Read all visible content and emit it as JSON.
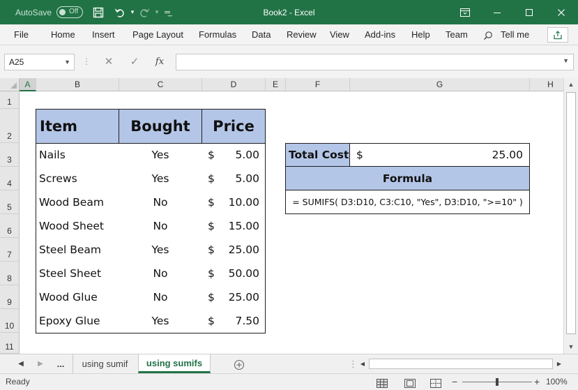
{
  "titlebar": {
    "autosave_label": "AutoSave",
    "autosave_state": "Off",
    "document_title": "Book2  -  Excel",
    "icons": [
      "save-icon",
      "undo-icon",
      "redo-icon",
      "customize-qat-icon",
      "ribbon-display-icon",
      "minimize-icon",
      "maximize-icon",
      "close-icon"
    ]
  },
  "ribbon": {
    "tabs": [
      "File",
      "Home",
      "Insert",
      "Page Layout",
      "Formulas",
      "Data",
      "Review",
      "View",
      "Add-ins",
      "Help",
      "Team"
    ],
    "tell_me": "Tell me"
  },
  "formula_bar": {
    "name_box": "A25",
    "fx_label": "fx",
    "formula": ""
  },
  "grid": {
    "columns": [
      "A",
      "B",
      "C",
      "D",
      "E",
      "F",
      "G",
      "H"
    ],
    "selected_column": "A",
    "rows": [
      "1",
      "2",
      "3",
      "4",
      "5",
      "6",
      "7",
      "8",
      "9",
      "10",
      "11"
    ]
  },
  "table": {
    "headers": [
      "Item",
      "Bought",
      "Price"
    ],
    "rows": [
      {
        "item": "Nails",
        "bought": "Yes",
        "currency": "$",
        "price": "5.00"
      },
      {
        "item": "Screws",
        "bought": "Yes",
        "currency": "$",
        "price": "5.00"
      },
      {
        "item": "Wood Beam",
        "bought": "No",
        "currency": "$",
        "price": "10.00"
      },
      {
        "item": "Wood Sheet",
        "bought": "No",
        "currency": "$",
        "price": "15.00"
      },
      {
        "item": "Steel Beam",
        "bought": "Yes",
        "currency": "$",
        "price": "25.00"
      },
      {
        "item": "Steel Sheet",
        "bought": "No",
        "currency": "$",
        "price": "50.00"
      },
      {
        "item": "Wood Glue",
        "bought": "No",
        "currency": "$",
        "price": "25.00"
      },
      {
        "item": "Epoxy Glue",
        "bought": "Yes",
        "currency": "$",
        "price": "7.50"
      }
    ]
  },
  "summary": {
    "total_label": "Total Cost",
    "currency": "$",
    "total_value": "25.00",
    "formula_header": "Formula",
    "formula_text": "= SUMIFS( D3:D10, C3:C10, \"Yes\", D3:D10, \">=10\" )"
  },
  "sheets": {
    "ellipsis": "...",
    "tabs": [
      "using sumif",
      "using sumifs"
    ],
    "active": "using sumifs"
  },
  "status": {
    "text": "Ready",
    "zoom": "100%",
    "zoom_level": 1.0
  },
  "colors": {
    "excel_green": "#217346",
    "table_header": "#b4c6e7"
  }
}
